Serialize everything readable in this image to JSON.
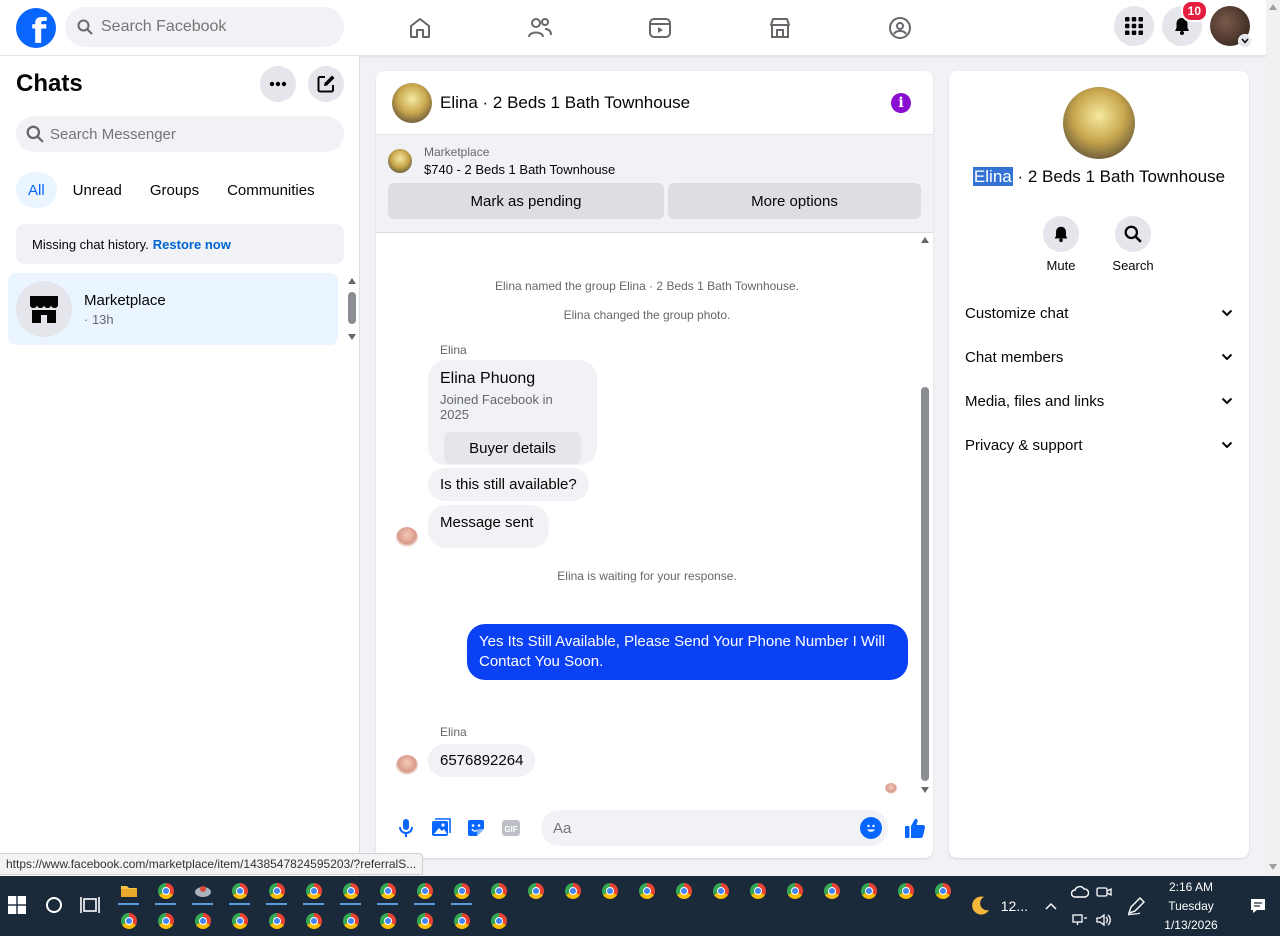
{
  "topbar": {
    "logo": "f",
    "search_placeholder": "Search Facebook",
    "notification_count": "10",
    "icons": [
      "home-icon",
      "friends-icon",
      "video-icon",
      "marketplace-icon",
      "groups-icon"
    ]
  },
  "sidebar": {
    "title": "Chats",
    "search_placeholder": "Search Messenger",
    "filters": [
      "All",
      "Unread",
      "Groups",
      "Communities"
    ],
    "missing_text": "Missing chat history.",
    "restore_link": "Restore now",
    "chat": {
      "name": "Marketplace",
      "time": "· 13h"
    }
  },
  "conversation": {
    "title": "Elina · 2 Beds 1 Bath Townhouse",
    "marketplace_label": "Marketplace",
    "listing": "$740 - 2 Beds 1 Bath Townhouse",
    "mark_pending": "Mark as pending",
    "more_options": "More options",
    "sys_named": "Elina named the group Elina · 2 Beds 1 Bath Townhouse.",
    "sys_photo": "Elina changed the group photo.",
    "sender1": "Elina",
    "card_name": "Elina Phuong",
    "card_sub": "Joined Facebook in 2025",
    "card_button": "Buyer details",
    "msg_available": "Is this still available?",
    "msg_sent": "Message sent",
    "sys_waiting": "Elina is waiting for your response.",
    "outgoing": "Yes Its Still Available, Please Send Your Phone Number I Will Contact You Soon.",
    "sender2": "Elina",
    "msg_phone": "6576892264",
    "composer_placeholder": "Aa"
  },
  "details": {
    "name_selected": "Elina",
    "name_rest": " · 2 Beds 1 Bath Townhouse",
    "mute": "Mute",
    "search": "Search",
    "sections": [
      "Customize chat",
      "Chat members",
      "Media, files and links",
      "Privacy & support"
    ]
  },
  "status_url": "https://www.facebook.com/marketplace/item/1438547824595203/?referralS...",
  "taskbar": {
    "weather": "12...",
    "time": "2:16 AM",
    "day": "Tuesday",
    "date": "1/13/2026"
  },
  "colors": {
    "brand": "#0866ff",
    "outgoing": "#0a41f5",
    "selected": "#3574d4",
    "badge": "#e41e3f"
  }
}
